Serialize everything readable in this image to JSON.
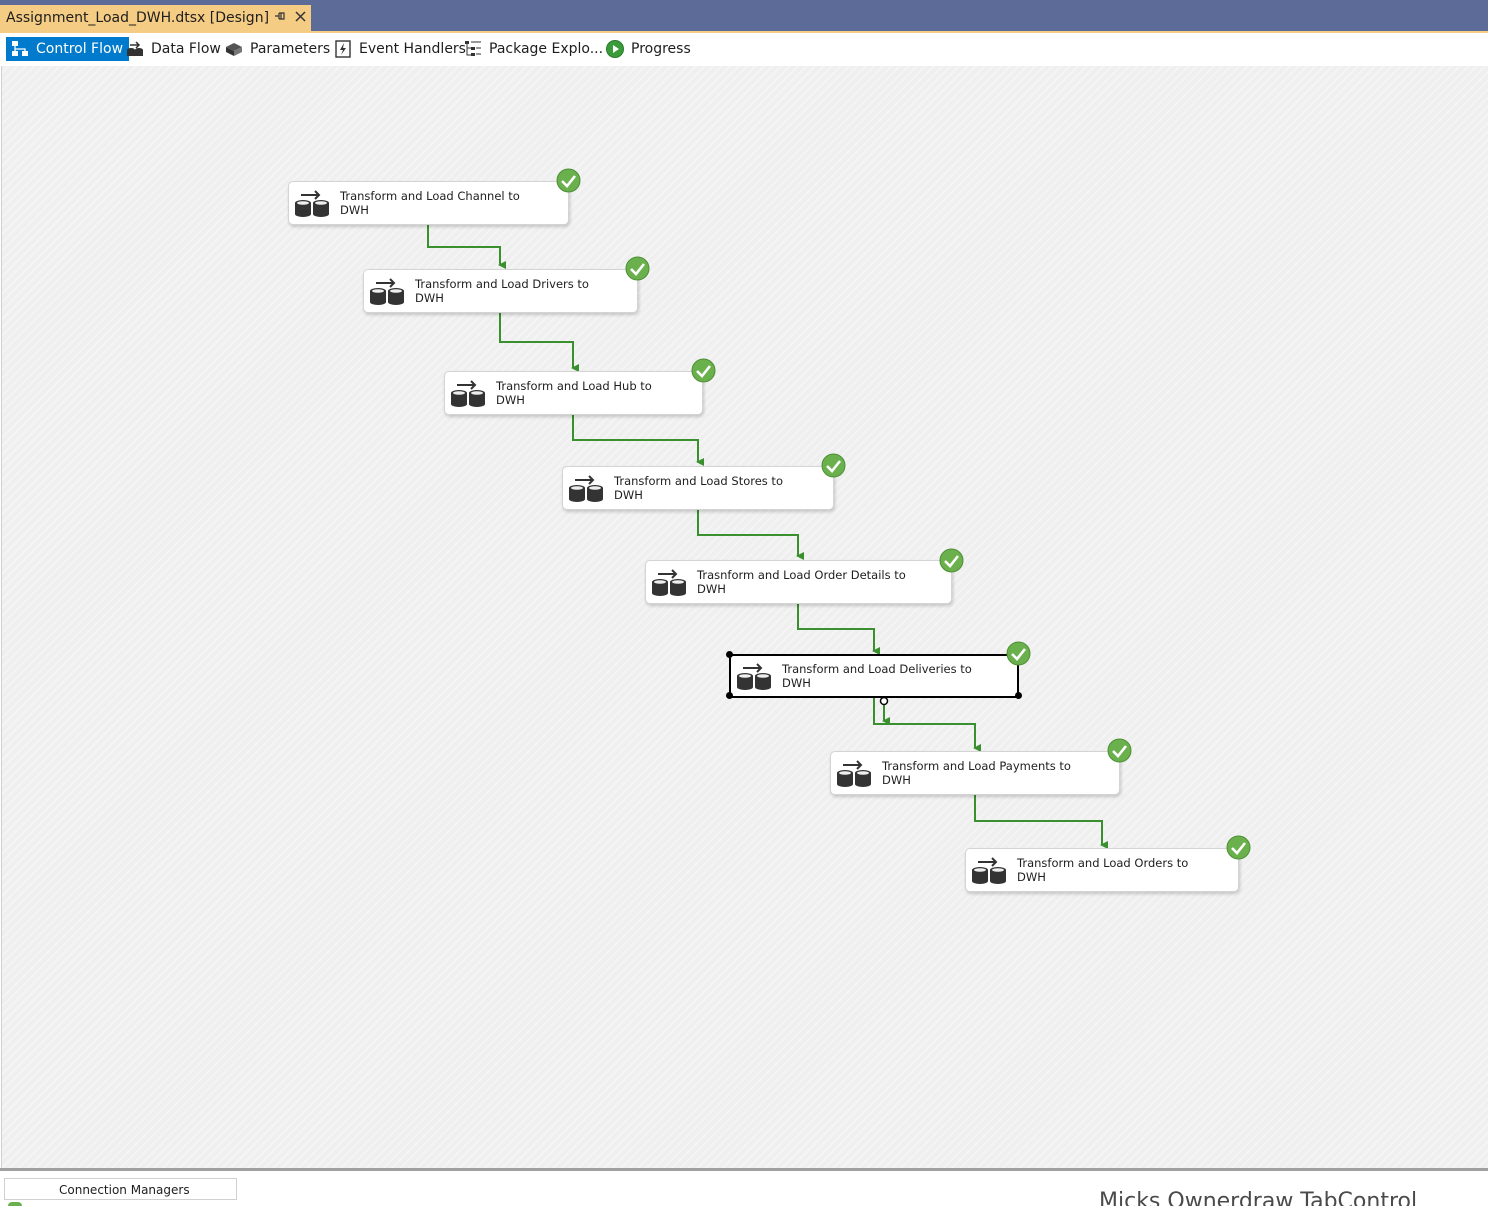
{
  "document_tab": {
    "title": "Assignment_Load_DWH.dtsx [Design]",
    "pin_icon": "pin-icon",
    "close_icon": "close-icon"
  },
  "designer_tabs": [
    {
      "label": "Control Flow",
      "icon": "control-flow-icon",
      "active": true
    },
    {
      "label": "Data Flow",
      "icon": "data-flow-icon",
      "active": false
    },
    {
      "label": "Parameters",
      "icon": "parameters-icon",
      "active": false
    },
    {
      "label": "Event Handlers",
      "icon": "event-handlers-icon",
      "active": false
    },
    {
      "label": "Package Explo...",
      "icon": "package-explorer-icon",
      "active": false
    },
    {
      "label": "Progress",
      "icon": "progress-icon",
      "active": false
    }
  ],
  "tasks": [
    {
      "label": "Transform and Load Channel to\nDWH",
      "status": "success"
    },
    {
      "label": "Transform and Load Drivers to\nDWH",
      "status": "success"
    },
    {
      "label": "Transform and Load Hub to\nDWH",
      "status": "success"
    },
    {
      "label": "Transform and Load Stores to\nDWH",
      "status": "success"
    },
    {
      "label": "Trasnform and Load Order Details to\nDWH",
      "status": "success"
    },
    {
      "label": "Transform and Load Deliveries to\nDWH",
      "status": "success",
      "selected": true
    },
    {
      "label": "Transform and Load Payments to\nDWH",
      "status": "success"
    },
    {
      "label": "Transform and Load Orders to\nDWH",
      "status": "success"
    }
  ],
  "connection_managers": {
    "label": "Connection Managers"
  },
  "background_text": "Micks Ownerdraw TabControl",
  "colors": {
    "accent": "#007acc",
    "tab_gold": "#f5cc84",
    "frame": "#5d6b99",
    "connector_green": "#3a8f2e",
    "success_green": "#6ab04c"
  }
}
